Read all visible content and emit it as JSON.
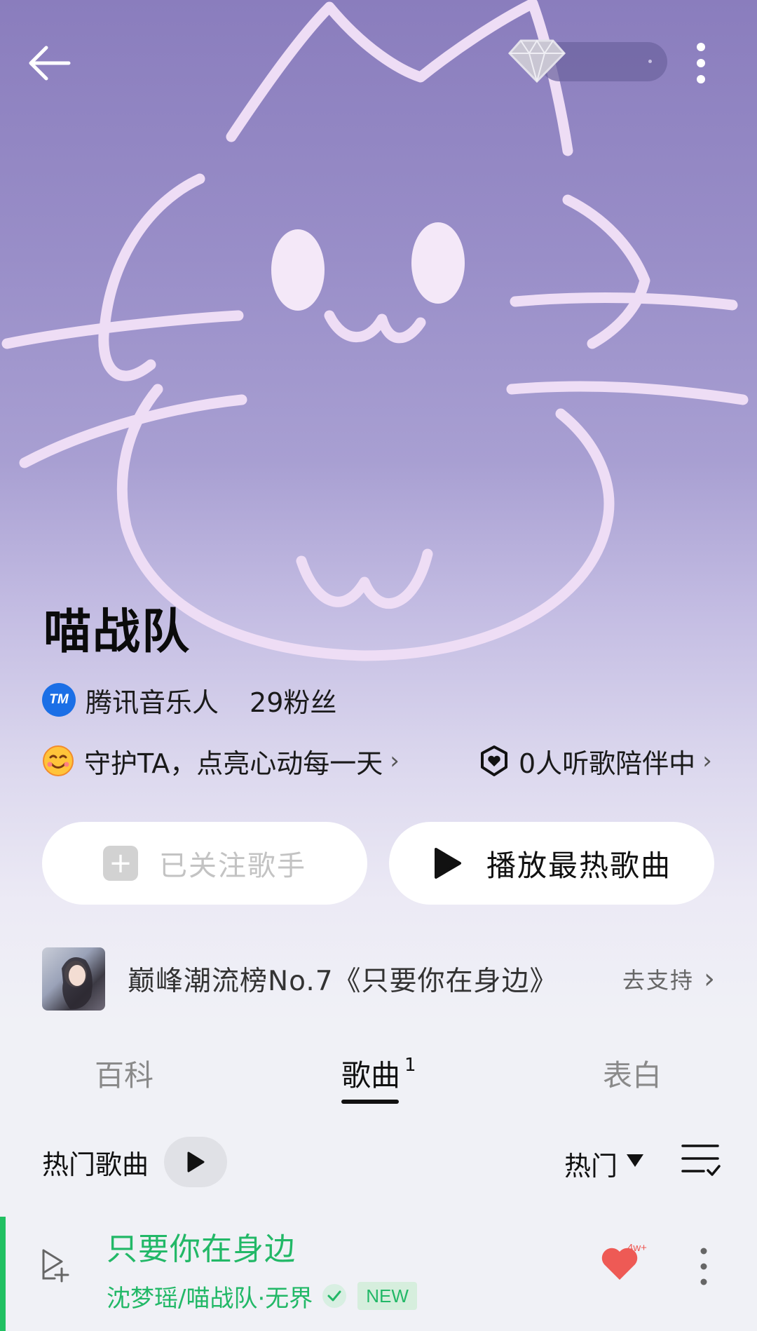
{
  "header": {
    "back_icon": "arrow-left-icon",
    "vip_icon": "diamond-icon",
    "more_icon": "more-vertical-icon"
  },
  "artist": {
    "name": "喵战队",
    "badge_icon": "tencent-musician-icon",
    "badge_label": "腾讯音乐人",
    "fans": "29粉丝"
  },
  "guard": {
    "text": "守护TA，点亮心动每一天",
    "chevron": "›"
  },
  "listeners": {
    "text": "0人听歌陪伴中",
    "chevron": "›"
  },
  "actions": {
    "follow_label": "已关注歌手",
    "follow_icon": "+",
    "play_hot_label": "播放最热歌曲"
  },
  "promo": {
    "text": "巅峰潮流榜No.7《只要你在身边》",
    "cta": "去支持",
    "chevron": "›"
  },
  "tabs": [
    {
      "label": "百科"
    },
    {
      "label": "歌曲",
      "count": "1",
      "active": true
    },
    {
      "label": "表白"
    }
  ],
  "song_section": {
    "title": "热门歌曲",
    "sort_label": "热门"
  },
  "songs": [
    {
      "title": "只要你在身边",
      "artist_album": "沈梦瑶/喵战队·无界",
      "badge": "NEW",
      "like_count": "4w+"
    }
  ],
  "colors": {
    "accent_green": "#22b867",
    "hero_purple": "#8a7dbd",
    "heart_red": "#ee5a55"
  }
}
